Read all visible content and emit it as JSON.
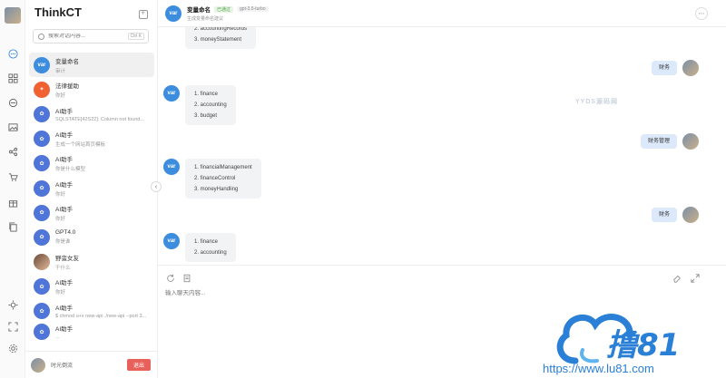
{
  "app": {
    "name": "ThinkCT"
  },
  "search": {
    "placeholder": "搜索对话内容...",
    "shortcut": "Ctrl K"
  },
  "conversations": [
    {
      "title": "变量命名",
      "subtitle": "审计",
      "avatar": "var",
      "active": true
    },
    {
      "title": "法律援助",
      "subtitle": "你好",
      "avatar": "law-icon"
    },
    {
      "title": "AI助手",
      "subtitle": "SQLSTATE[42S22]: Column not found...",
      "avatar": "bot-icon"
    },
    {
      "title": "AI助手",
      "subtitle": "生成一个网站首页模板",
      "avatar": "bot-icon"
    },
    {
      "title": "AI助手",
      "subtitle": "你是什么模型",
      "avatar": "bot-icon"
    },
    {
      "title": "AI助手",
      "subtitle": "你好",
      "avatar": "bot-icon"
    },
    {
      "title": "AI助手",
      "subtitle": "你好",
      "avatar": "bot-icon"
    },
    {
      "title": "GPT4.0",
      "subtitle": "你是谁",
      "avatar": "bot-icon"
    },
    {
      "title": "野蛮女友",
      "subtitle": "干什么",
      "avatar": "girl-photo"
    },
    {
      "title": "AI助手",
      "subtitle": "你好",
      "avatar": "bot-icon"
    },
    {
      "title": "AI助手",
      "subtitle": "$ chmod u+x new-api ./new-api --port 3...",
      "avatar": "bot-icon"
    },
    {
      "title": "AI助手",
      "subtitle": "...",
      "avatar": "bot-icon"
    }
  ],
  "footer": {
    "user_name": "时光倒流",
    "logout_label": "退出"
  },
  "chat": {
    "title": "变量命名",
    "badge": "已通过",
    "model": "gpt-3.5-turbo",
    "description": "生成变量命名建议",
    "avatar_label": "var",
    "watermark": "YYDS源码网",
    "messages": [
      {
        "role": "bot",
        "items": [
          "2. accountingRecords",
          "3. moneyStatement"
        ]
      },
      {
        "role": "user",
        "text": "财务"
      },
      {
        "role": "bot",
        "items": [
          "1. finance",
          "2. accounting",
          "3. budget"
        ]
      },
      {
        "role": "user",
        "text": "财务管理"
      },
      {
        "role": "bot",
        "items": [
          "1. financialManagement",
          "2. financeControl",
          "3. moneyHandling"
        ]
      },
      {
        "role": "user",
        "text": "财务"
      },
      {
        "role": "bot",
        "items": [
          "1. finance",
          "2. accounting"
        ]
      }
    ]
  },
  "composer": {
    "placeholder": "输入聊天内容..."
  },
  "brand_overlay": {
    "logo_text": "撸81",
    "url": "https://www.lu81.com"
  },
  "colors": {
    "accent": "#3c8dde",
    "logout": "#e8605a",
    "user_bubble": "#dbe9fb",
    "bot_bubble": "#f2f3f5"
  }
}
